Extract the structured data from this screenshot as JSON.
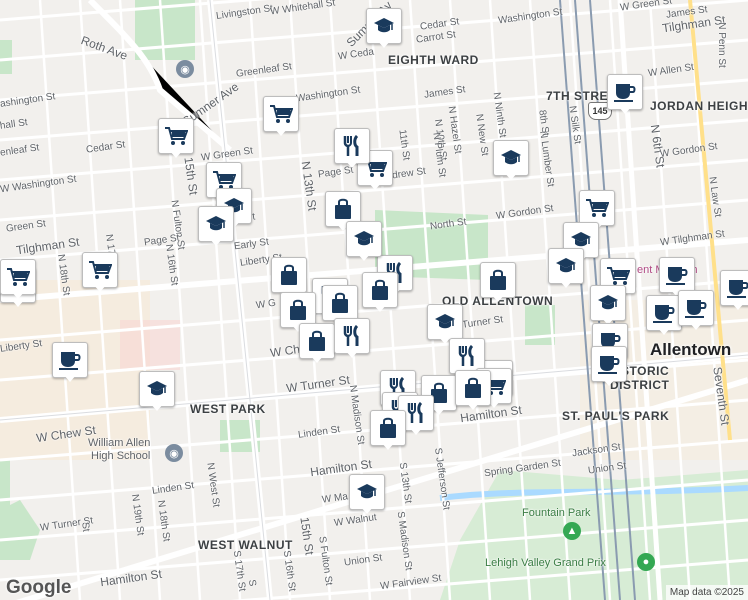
{
  "attribution": "Map data ©2025",
  "logo": "Google",
  "highway_shield": "145",
  "neighborhoods": {
    "eighth_ward": "EIGHTH WARD",
    "seventh_street": "7TH STREET",
    "jordan_heights": "JORDAN HEIGH",
    "old_allentown": "OLD ALLENTOWN",
    "west_park": "WEST PARK",
    "st_pauls_park": "ST. PAUL'S PARK",
    "west_walnut": "WEST WALNUT",
    "historic_district_1": "HISTORIC",
    "historic_district_2": "DISTRICT"
  },
  "city": "Allentown",
  "pois": {
    "high_school": "William Allen\nHigh School",
    "fountain_park": "Fountain Park",
    "grand_prix": "Lehigh Valley Grand Prix",
    "art_museum": "ent Museum"
  },
  "streets": {
    "livingston": "Livingston St",
    "w_whitehall": "W Whitehall St",
    "cedar_top": "Cedar St",
    "carrot": "Carrot St",
    "washington_top": "Washington St",
    "w_green_top": "W Green St",
    "james_top": "James St",
    "tilghman_top": "Tilghman St",
    "n_penn": "N Penn St",
    "roth": "Roth Ave",
    "greenleaf_top": "Greenleaf St",
    "w_cedar": "W Ceda",
    "sumner_top": "Sumner Av",
    "w_allen": "W Allen St",
    "ashington": "Washington St",
    "james": "James St",
    "chall": "hall St",
    "enleaf": "enleaf St",
    "cedar_left": "Cedar St",
    "sumner_ave": "Sumner Ave",
    "w_green": "W Green St",
    "n_13th": "N 13th St",
    "page_top": "Page St",
    "andrew": "Andrew St",
    "n_10th": "N 10th St",
    "n_hazel": "N Hazel St",
    "n_plum": "N Plum St",
    "n_new": "N New St",
    "n_ninth": "N Ninth St",
    "n_lumber": "N Lumber St",
    "n_silk": "N Silk St",
    "eighth": "8th St",
    "n_6th": "N 6th St",
    "w_gordon": "W Gordon St",
    "n_gordon": "N Gordon St",
    "w_gordon_mid": "W Gordon St",
    "w_tilghman_right": "W Tilghman St",
    "n_law": "N Law St",
    "north": "North St",
    "eleventh": "11th St",
    "w_washington": "W Washington St",
    "lashington": "ashington St",
    "green": "Green St",
    "tilghman": "Tilghman St",
    "n_fulton": "N Fulton St",
    "fifteenth": "15th St",
    "n_16th": "N 16th St",
    "n_17th": "N 17th St",
    "n_18th": "N 18th St",
    "page": "Page St",
    "early": "Early St",
    "liberty": "Liberty St",
    "liberty_left": "Liberty St",
    "w_turner_mid": "W Turner St",
    "turner_right": "Turner St",
    "w_ch": "W Ch",
    "w_chew": "W Chew St",
    "linden": "Linden St",
    "linden_left": "Linden St",
    "n_madison": "N Madison St",
    "hamilton": "Hamilton St",
    "hamilton_left": "Hamilton St",
    "hamilton_mid": "Hamilton St",
    "w_turner_left": "W Turner St",
    "n_west": "N West St",
    "n_19th": "N 19th St",
    "s_madison": "S Madison St",
    "s_13th": "S 13th St",
    "s_jefferson": "S Jefferson St",
    "jackson": "Jackson St",
    "union": "Union St",
    "union_mid": "Union St",
    "spring_garden": "Spring Garden St",
    "seventh": "Seventh St",
    "w_walnut": "W Walnut",
    "w_ma": "W Ma",
    "w_fairview": "W Fairview St",
    "fifteenth_s": "15th St",
    "s_fulton": "S Fulton St",
    "s_16th": "S 16th St",
    "s_17th": "S 17th St",
    "s_18th": "S",
    "w_gi": "W G",
    "w_ed": "ed St",
    "st_left": "St"
  },
  "markers": [
    {
      "type": "school",
      "name": "school-marker"
    },
    {
      "type": "grocery",
      "name": "grocery-marker"
    },
    {
      "type": "grocery",
      "name": "grocery-marker"
    },
    {
      "type": "grocery",
      "name": "grocery-marker"
    },
    {
      "type": "restaurant",
      "name": "restaurant-marker"
    },
    {
      "type": "grocery",
      "name": "grocery-marker"
    },
    {
      "type": "school",
      "name": "school-marker"
    },
    {
      "type": "coffee",
      "name": "coffee-marker"
    },
    {
      "type": "school",
      "name": "school-marker"
    },
    {
      "type": "grocery",
      "name": "grocery-marker"
    },
    {
      "type": "restaurant",
      "name": "restaurant-marker"
    },
    {
      "type": "shopping",
      "name": "shopping-marker"
    },
    {
      "type": "school",
      "name": "school-marker"
    },
    {
      "type": "school",
      "name": "school-marker"
    },
    {
      "type": "grocery",
      "name": "grocery-marker"
    },
    {
      "type": "school",
      "name": "school-marker"
    },
    {
      "type": "grocery",
      "name": "grocery-marker"
    },
    {
      "type": "school",
      "name": "school-marker"
    },
    {
      "type": "shopping",
      "name": "shopping-marker"
    },
    {
      "type": "restaurant",
      "name": "restaurant-marker"
    },
    {
      "type": "coffee",
      "name": "coffee-marker"
    },
    {
      "type": "shopping",
      "name": "shopping-marker"
    },
    {
      "type": "shopping",
      "name": "shopping-marker"
    },
    {
      "type": "shopping",
      "name": "shopping-marker"
    },
    {
      "type": "restaurant",
      "name": "restaurant-marker"
    },
    {
      "type": "shopping",
      "name": "shopping-marker"
    },
    {
      "type": "school",
      "name": "school-marker"
    },
    {
      "type": "shopping",
      "name": "shopping-marker"
    },
    {
      "type": "school",
      "name": "school-marker"
    },
    {
      "type": "grocery",
      "name": "grocery-marker"
    },
    {
      "type": "coffee",
      "name": "coffee-marker"
    },
    {
      "type": "coffee",
      "name": "coffee-marker"
    },
    {
      "type": "coffee",
      "name": "coffee-marker"
    },
    {
      "type": "coffee",
      "name": "coffee-marker"
    },
    {
      "type": "coffee",
      "name": "coffee-marker"
    },
    {
      "type": "coffee",
      "name": "coffee-marker"
    },
    {
      "type": "restaurant",
      "name": "restaurant-marker"
    },
    {
      "type": "restaurant",
      "name": "restaurant-marker"
    },
    {
      "type": "grocery",
      "name": "grocery-marker"
    },
    {
      "type": "shopping",
      "name": "shopping-marker"
    },
    {
      "type": "shopping",
      "name": "shopping-marker"
    },
    {
      "type": "restaurant",
      "name": "restaurant-marker"
    },
    {
      "type": "restaurant",
      "name": "restaurant-marker"
    },
    {
      "type": "shopping",
      "name": "shopping-marker"
    },
    {
      "type": "school",
      "name": "school-marker"
    },
    {
      "type": "coffee",
      "name": "coffee-marker"
    },
    {
      "type": "school",
      "name": "school-marker"
    },
    {
      "type": "grocery",
      "name": "grocery-marker"
    }
  ],
  "colors": {
    "marker_icon": "#1a3a5c",
    "park": "#c8e6c9",
    "road": "#ffffff",
    "land": "#f2f0ed",
    "railway": "#5e7b9c",
    "water": "#aadaff"
  }
}
